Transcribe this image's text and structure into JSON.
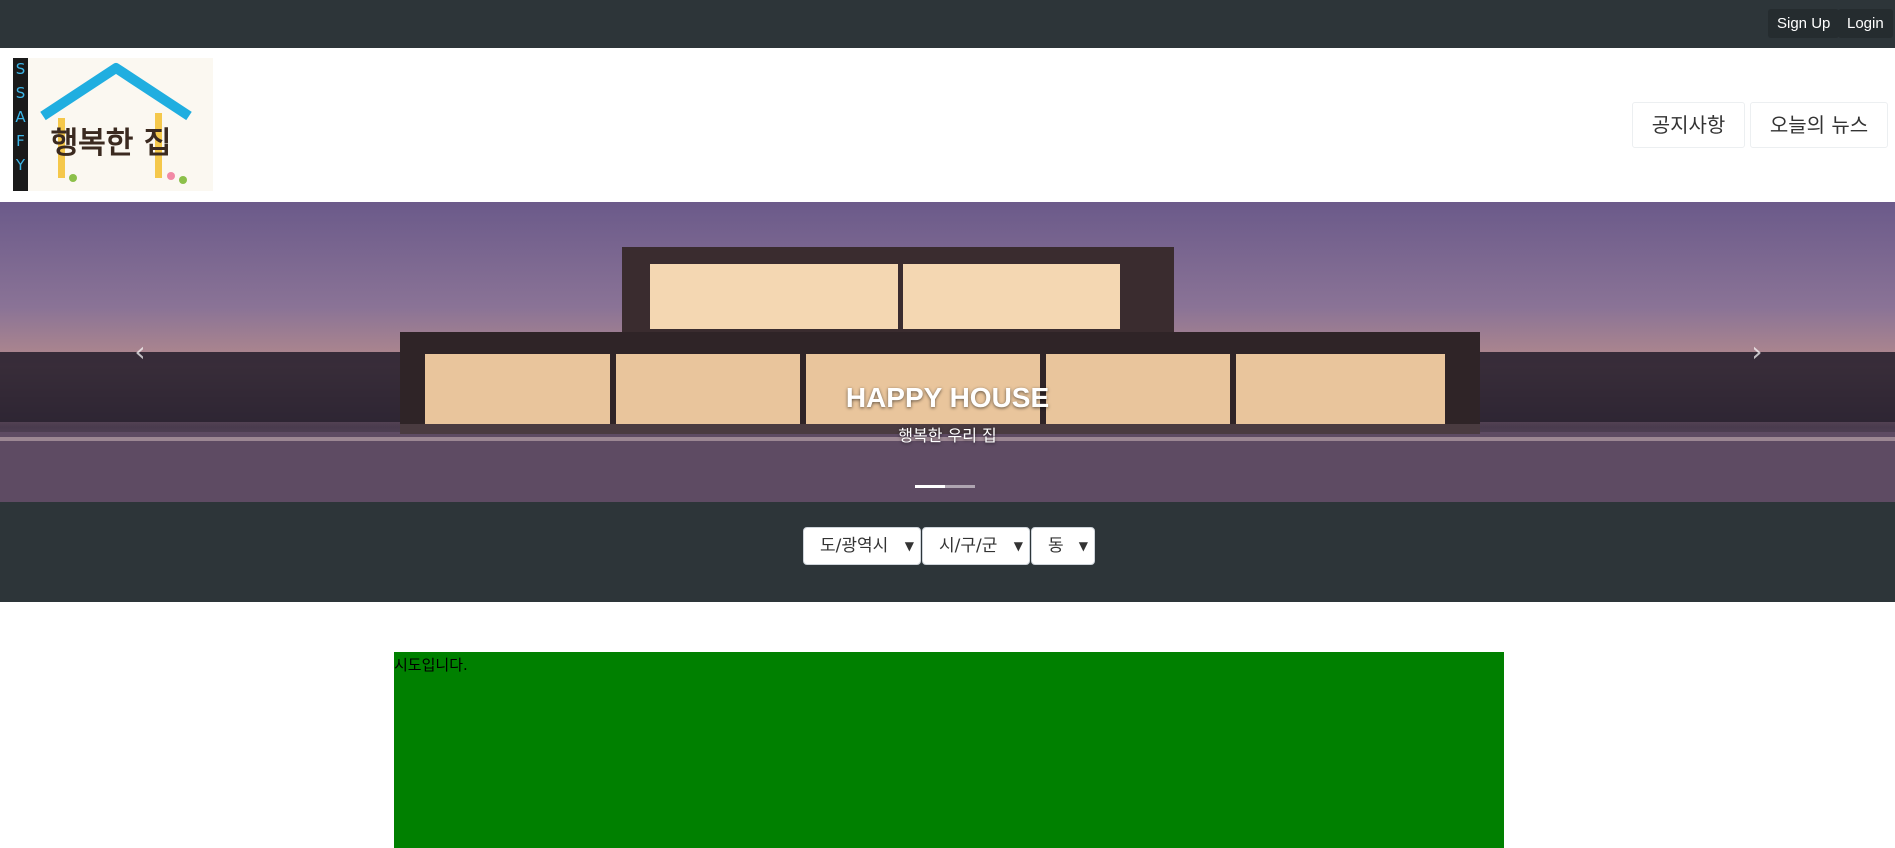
{
  "topbar": {
    "signup_label": "Sign Up",
    "login_label": "Login"
  },
  "header": {
    "nav_notice": "공지사항",
    "nav_news": "오늘의 뉴스"
  },
  "logo": {
    "side_text": "SSAFY",
    "main_text": "행복한 집"
  },
  "carousel": {
    "title": "HAPPY HOUSE",
    "subtitle": "행복한 우리 집",
    "prev_icon": "chevron-left-icon",
    "next_icon": "chevron-right-icon",
    "slide_count": 2,
    "active_slide": 1
  },
  "filters": {
    "sido": "도/광역시",
    "gugun": "시/구/군",
    "dong": "동"
  },
  "map": {
    "text": "시도입니다."
  },
  "colors": {
    "topbar_bg": "#2d3539",
    "map_bg": "#008000"
  }
}
